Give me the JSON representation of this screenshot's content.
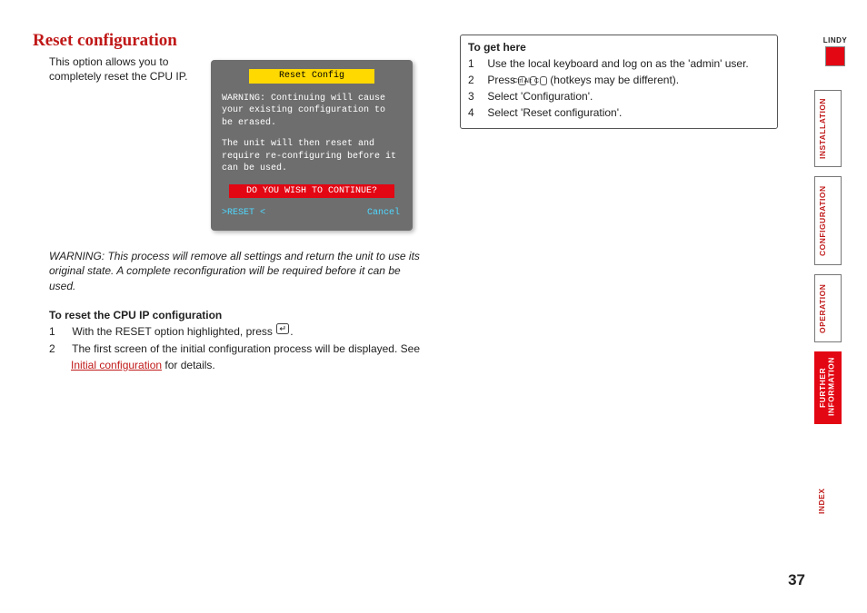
{
  "page_number": "37",
  "brand": "LINDY",
  "title": "Reset configuration",
  "intro": "This option allows you to completely reset the CPU IP.",
  "dialog": {
    "header": "Reset Config",
    "warn1": "WARNING: Continuing will cause your existing configuration to be erased.",
    "warn2": "The unit will then reset and require re-configuring before it can be used.",
    "prompt": "DO YOU WISH TO CONTINUE?",
    "reset_btn": ">RESET <",
    "cancel_btn": "Cancel"
  },
  "warning_note": "WARNING: This process will remove all settings and return the unit to use its original state. A complete reconfiguration will be required before it can be used.",
  "reset_steps": {
    "header": "To reset the CPU IP configuration",
    "s1_a": "With the RESET option highlighted, press ",
    "s1_b": ".",
    "s2_a": "The first screen of the initial configuration process will be displayed. See ",
    "s2_link": "Initial configuration",
    "s2_b": " for details."
  },
  "to_get_here": {
    "header": "To get here",
    "s1": "Use the local keyboard and log on as the 'admin' user.",
    "s2_a": "Press ",
    "s2_k1": "Ctrl",
    "s2_k2": "Alt",
    "s2_k3": "C",
    "s2_b": " (hotkeys may be different).",
    "s3": "Select 'Configuration'.",
    "s4": "Select 'Reset configuration'."
  },
  "tabs": {
    "installation": "INSTALLATION",
    "configuration": "CONFIGURATION",
    "operation": "OPERATION",
    "further": "FURTHER\nINFORMATION",
    "index": "INDEX"
  }
}
